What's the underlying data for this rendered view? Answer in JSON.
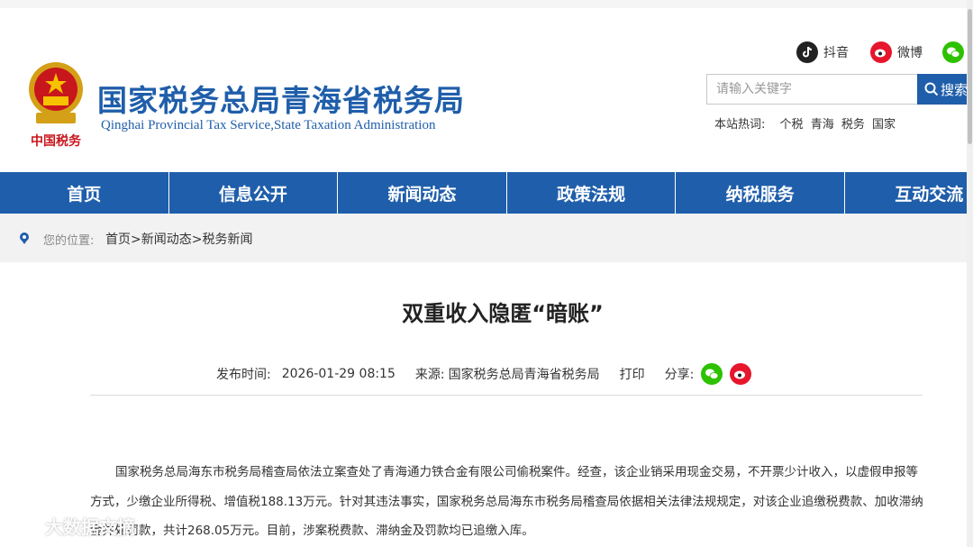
{
  "header": {
    "title_cn": "国家税务总局青海省税务局",
    "title_en": "Qinghai Provincial Tax Service,State Taxation Administration",
    "emblem_text": "中国税务"
  },
  "social": {
    "douyin": "抖音",
    "weibo": "微博",
    "wechat_icon": "wechat-icon"
  },
  "search": {
    "placeholder": "请输入关键字",
    "button_label": "搜索"
  },
  "hot": {
    "label": "本站热词:",
    "words": [
      "个税",
      "青海",
      "税务",
      "国家"
    ]
  },
  "nav": {
    "items": [
      "首页",
      "信息公开",
      "新闻动态",
      "政策法规",
      "纳税服务",
      "互动交流"
    ]
  },
  "breadcrumb": {
    "label": "您的位置:",
    "path": "首页>新闻动态>税务新闻"
  },
  "article": {
    "title": "双重收入隐匿“暗账”",
    "publish_label": "发布时间:",
    "publish_time": "2026-01-29 08:15",
    "source_label": "来源:",
    "source": "国家税务总局青海省税务局",
    "print": "打印",
    "share": "分享:",
    "body": "国家税务总局海东市税务局稽查局依法立案查处了青海通力铁合金有限公司偷税案件。经查，该企业销采用现金交易，不开票少计收入，以虚假申报等方式，少缴企业所得税、增值税188.13万元。针对其违法事实，国家税务总局海东市税务局稽查局依据相关法律法规规定，对该企业追缴税费款、加收滞纳金并处罚款，共计268.05万元。目前，涉案税费款、滞纳金及罚款均已追缴入库。"
  },
  "watermark": {
    "text": "大数据文摘"
  },
  "colors": {
    "brand_blue": "#1f5eaa",
    "crumb_bg": "#f2f2f2",
    "weibo_red": "#e6162d",
    "wechat_green": "#2dc100"
  }
}
